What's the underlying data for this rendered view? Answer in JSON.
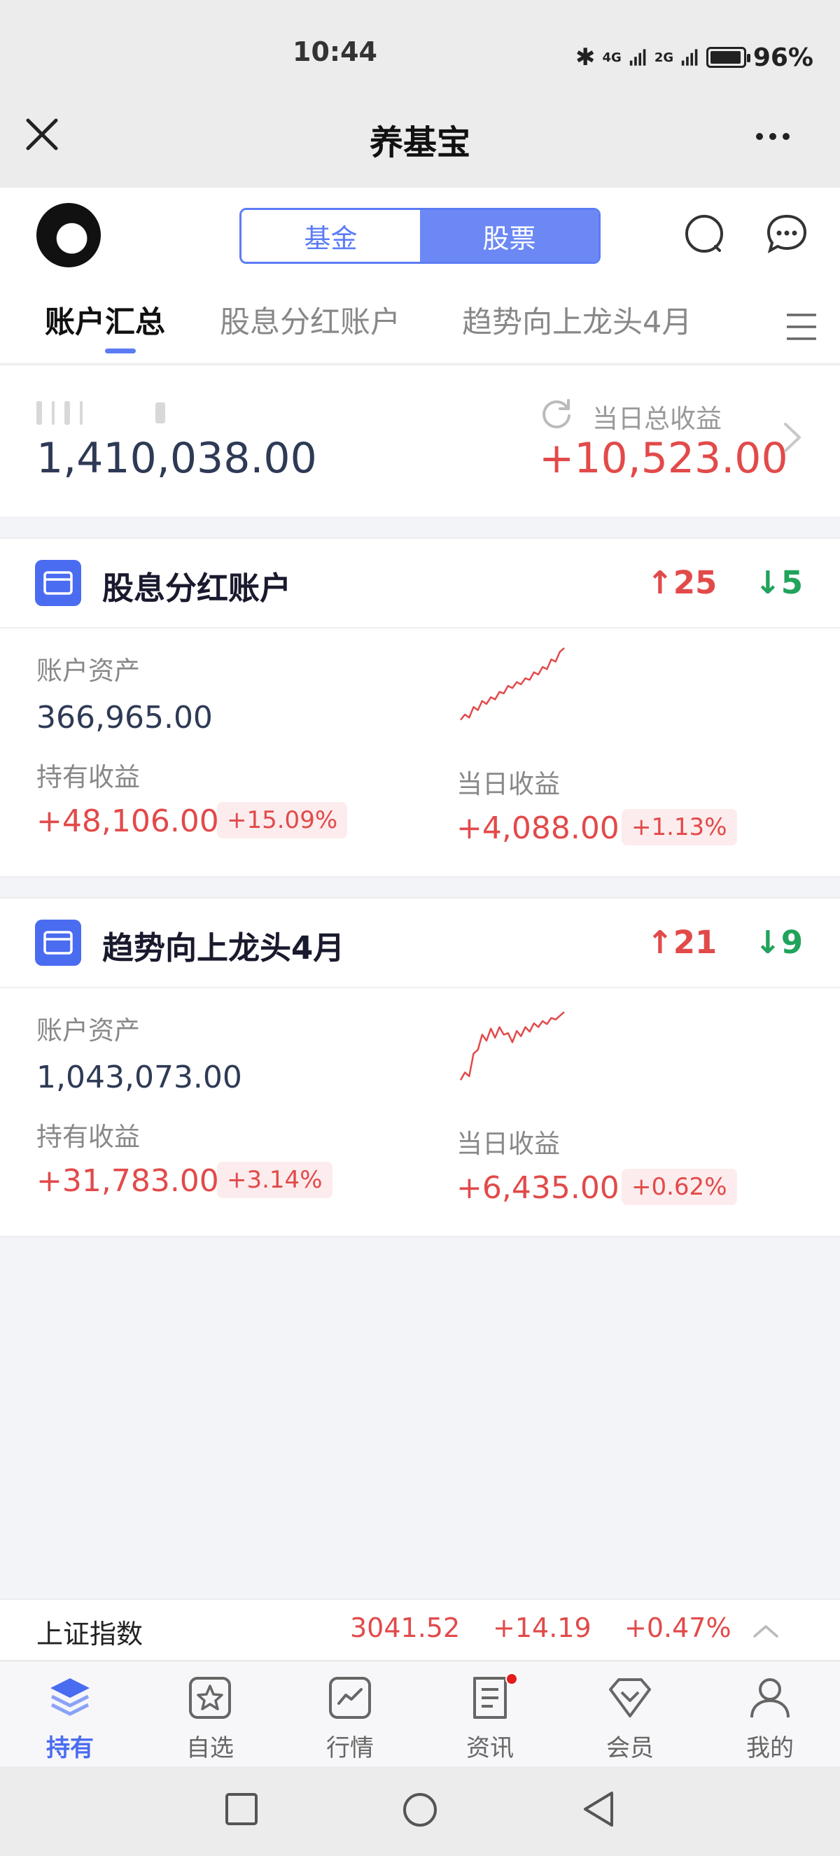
{
  "status_bar": {
    "time": "10:44",
    "network_1": "4G",
    "network_2": "2G",
    "battery": "96%",
    "battery_level": 0.96
  },
  "title_bar": {
    "title": "养基宝"
  },
  "header": {
    "segments": [
      {
        "label": "基金",
        "active": false
      },
      {
        "label": "股票",
        "active": true
      }
    ],
    "tabs": [
      {
        "label": "账户汇总",
        "active": true
      },
      {
        "label": "股息分红账户"
      },
      {
        "label": "趋势向上龙头4月"
      }
    ]
  },
  "summary": {
    "total_assets": "1,410,038.00",
    "daily_label": "当日总收益",
    "daily_total": "+10,523.00"
  },
  "accounts": [
    {
      "name": "股息分红账户",
      "up": "25",
      "down": "5",
      "assets_label": "账户资产",
      "assets": "366,965.00",
      "hold_label": "持有收益",
      "hold_gain": "+48,106.00",
      "hold_pct": "+15.09%",
      "daily_label": "当日收益",
      "daily_gain": "+4,088.00",
      "daily_pct": "+1.13%",
      "sparkline": [
        0.05,
        0.12,
        0.08,
        0.22,
        0.18,
        0.3,
        0.26,
        0.35,
        0.32,
        0.42,
        0.4,
        0.5,
        0.47,
        0.55,
        0.52,
        0.6,
        0.58,
        0.68,
        0.65,
        0.75,
        0.72,
        0.85,
        0.82,
        0.95,
        1.0
      ]
    },
    {
      "name": "趋势向上龙头4月",
      "up": "21",
      "down": "9",
      "assets_label": "账户资产",
      "assets": "1,043,073.00",
      "hold_label": "持有收益",
      "hold_gain": "+31,783.00",
      "hold_pct": "+3.14%",
      "daily_label": "当日收益",
      "daily_gain": "+6,435.00",
      "daily_pct": "+0.62%",
      "sparkline": [
        0.1,
        0.2,
        0.15,
        0.45,
        0.5,
        0.7,
        0.62,
        0.78,
        0.66,
        0.8,
        0.7,
        0.72,
        0.6,
        0.75,
        0.68,
        0.8,
        0.74,
        0.85,
        0.8,
        0.88,
        0.84,
        0.92,
        0.9,
        0.95,
        1.0
      ]
    }
  ],
  "index_bar": {
    "name": "上证指数",
    "value": "3041.52",
    "change": "+14.19",
    "change_pct": "+0.47%"
  },
  "bottom_nav": [
    {
      "label": "持有",
      "icon": "layers-icon",
      "active": true
    },
    {
      "label": "自选",
      "icon": "star-icon"
    },
    {
      "label": "行情",
      "icon": "chart-icon"
    },
    {
      "label": "资讯",
      "icon": "news-icon",
      "badge": true
    },
    {
      "label": "会员",
      "icon": "diamond-icon"
    },
    {
      "label": "我的",
      "icon": "user-icon"
    }
  ],
  "colors": {
    "accent": "#5b7cf5",
    "gain": "#e24a4a",
    "loss": "#21a35c"
  }
}
